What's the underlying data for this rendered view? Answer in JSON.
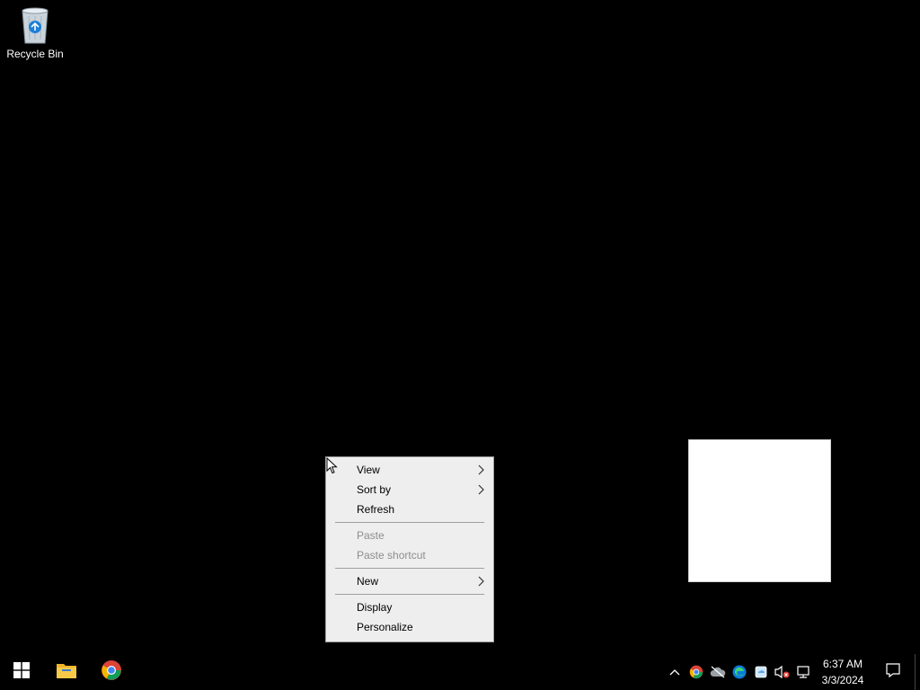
{
  "desktop": {
    "icons": [
      {
        "label": "Recycle Bin",
        "icon": "recycle-bin-icon"
      }
    ]
  },
  "context_menu": {
    "items": [
      {
        "label": "View",
        "submenu": true,
        "disabled": false
      },
      {
        "label": "Sort by",
        "submenu": true,
        "disabled": false
      },
      {
        "label": "Refresh",
        "submenu": false,
        "disabled": false
      },
      {
        "label": "Paste",
        "submenu": false,
        "disabled": true
      },
      {
        "label": "Paste shortcut",
        "submenu": false,
        "disabled": true
      },
      {
        "label": "New",
        "submenu": true,
        "disabled": false
      },
      {
        "label": "Display",
        "submenu": false,
        "disabled": false
      },
      {
        "label": "Personalize",
        "submenu": false,
        "disabled": false
      }
    ]
  },
  "taskbar": {
    "start_icon": "windows-start-icon",
    "pinned": [
      "file-explorer-icon",
      "chrome-icon"
    ],
    "tray_icons": [
      "chevron-up-icon",
      "chrome-tray-icon",
      "cloud-offline-icon",
      "edge-icon",
      "onedrive-icon",
      "volume-muted-icon",
      "network-icon"
    ],
    "clock": {
      "time": "6:37 AM",
      "date": "3/3/2024"
    },
    "notification_icon": "action-center-icon"
  },
  "colors": {
    "desktop_bg": "#000000",
    "menu_bg": "#eeeeee",
    "menu_disabled_text": "#8d8d8d",
    "taskbar_bg": "#000000"
  }
}
